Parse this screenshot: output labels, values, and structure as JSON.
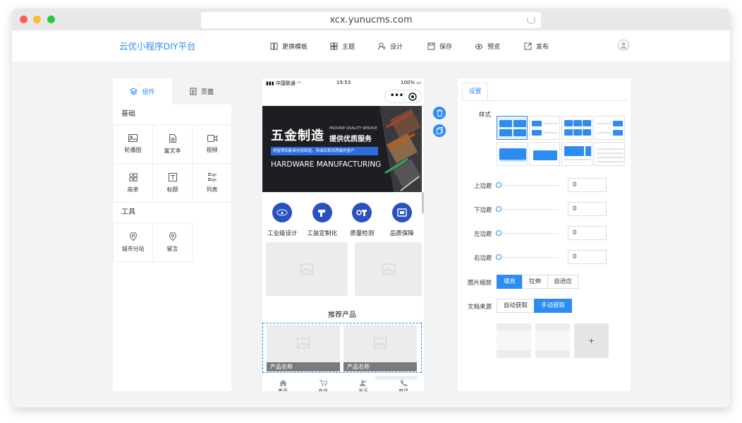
{
  "browser": {
    "url": "xcx.yunucms.com"
  },
  "header": {
    "brand": "云优小程序DIY平台",
    "nav": [
      {
        "label": "更换模板",
        "icon": "template-icon"
      },
      {
        "label": "主题",
        "icon": "theme-icon"
      },
      {
        "label": "设计",
        "icon": "design-icon"
      },
      {
        "label": "保存",
        "icon": "save-icon"
      },
      {
        "label": "预览",
        "icon": "preview-icon"
      },
      {
        "label": "发布",
        "icon": "publish-icon"
      }
    ]
  },
  "left": {
    "tabs": [
      {
        "label": "组件"
      },
      {
        "label": "页面"
      }
    ],
    "sections": [
      {
        "title": "基础",
        "items": [
          {
            "label": "轮播图"
          },
          {
            "label": "富文本"
          },
          {
            "label": "视频"
          },
          {
            "label": "商单"
          },
          {
            "label": "标题"
          },
          {
            "label": "列表"
          }
        ]
      },
      {
        "title": "工具",
        "items": [
          {
            "label": "城市分站"
          },
          {
            "label": "留言"
          }
        ]
      }
    ]
  },
  "phone": {
    "status": {
      "carrier": "中国联通",
      "time": "19:53",
      "battery": "100%"
    },
    "banner": {
      "title": "五金制造",
      "en_small": "PROVIDE QUALITY SERVICE",
      "subtitle": "提供优质服务",
      "tagline": "用智慧和勤奋创造辉煌，用诚实和优质赢的客户",
      "en_title": "HARDWARE MANUFACTURING"
    },
    "features": [
      {
        "label": "工业级设计"
      },
      {
        "label": "工装定制化"
      },
      {
        "label": "质量检测"
      },
      {
        "label": "品质保障"
      }
    ],
    "recommend_title": "推荐产品",
    "products": [
      {
        "label": "产品名称"
      },
      {
        "label": "产品名称"
      }
    ],
    "tabbar": [
      {
        "label": "首页"
      },
      {
        "label": "产品"
      },
      {
        "label": "关于"
      },
      {
        "label": "电话"
      }
    ]
  },
  "right": {
    "tab": "设置",
    "style_label": "样式",
    "margins": [
      {
        "label": "上边距",
        "value": "0"
      },
      {
        "label": "下边距",
        "value": "0"
      },
      {
        "label": "左边距",
        "value": "0"
      },
      {
        "label": "右边距",
        "value": "0"
      }
    ],
    "scale_label": "图片缩放",
    "scale_options": [
      "填充",
      "拉伸",
      "自适应"
    ],
    "scale_selected": "填充",
    "source_label": "文档来源",
    "source_options": [
      "自动获取",
      "手动获取"
    ],
    "source_selected": "手动获取",
    "add_symbol": "+"
  },
  "colors": {
    "accent": "#2d8cf0",
    "feature_circle": "#2a52be",
    "selection_dash": "#2d8cf0"
  }
}
